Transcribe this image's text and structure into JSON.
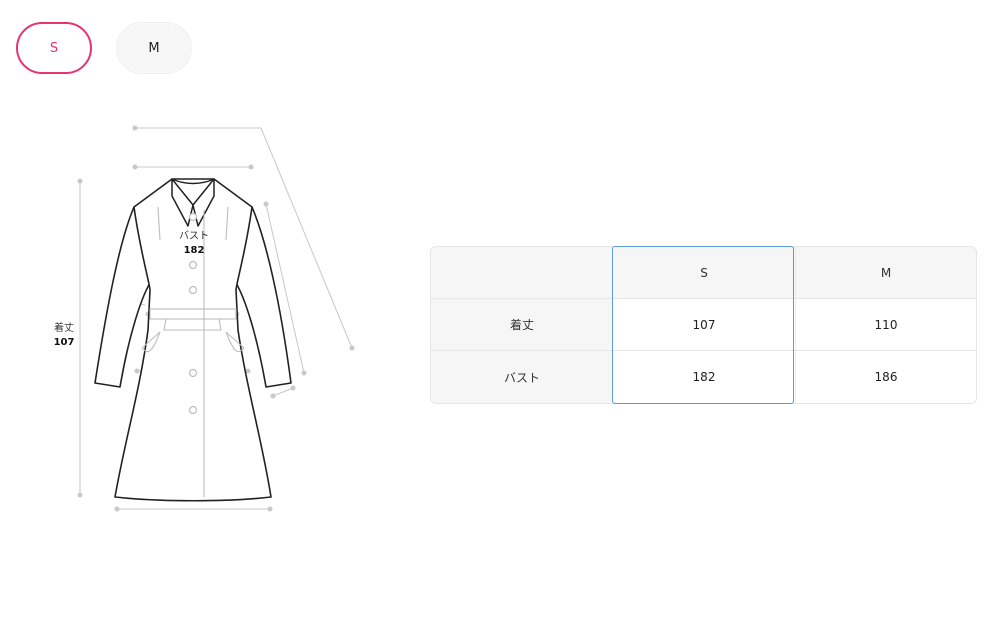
{
  "size_tabs": [
    {
      "label": "S",
      "selected": true
    },
    {
      "label": "M",
      "selected": false
    }
  ],
  "diagram": {
    "bust": {
      "name": "バスト",
      "value": "182"
    },
    "length": {
      "name": "着丈",
      "value": "107"
    }
  },
  "table": {
    "columns": [
      "",
      "S",
      "M"
    ],
    "rows": [
      {
        "label": "着丈",
        "values": [
          "107",
          "110"
        ]
      },
      {
        "label": "バスト",
        "values": [
          "182",
          "186"
        ]
      }
    ],
    "highlighted_column": "S"
  },
  "colors": {
    "accent": "#e8336f",
    "highlight": "#5b9be0",
    "outline": "#222222",
    "measure_line": "#c8c8c8"
  }
}
